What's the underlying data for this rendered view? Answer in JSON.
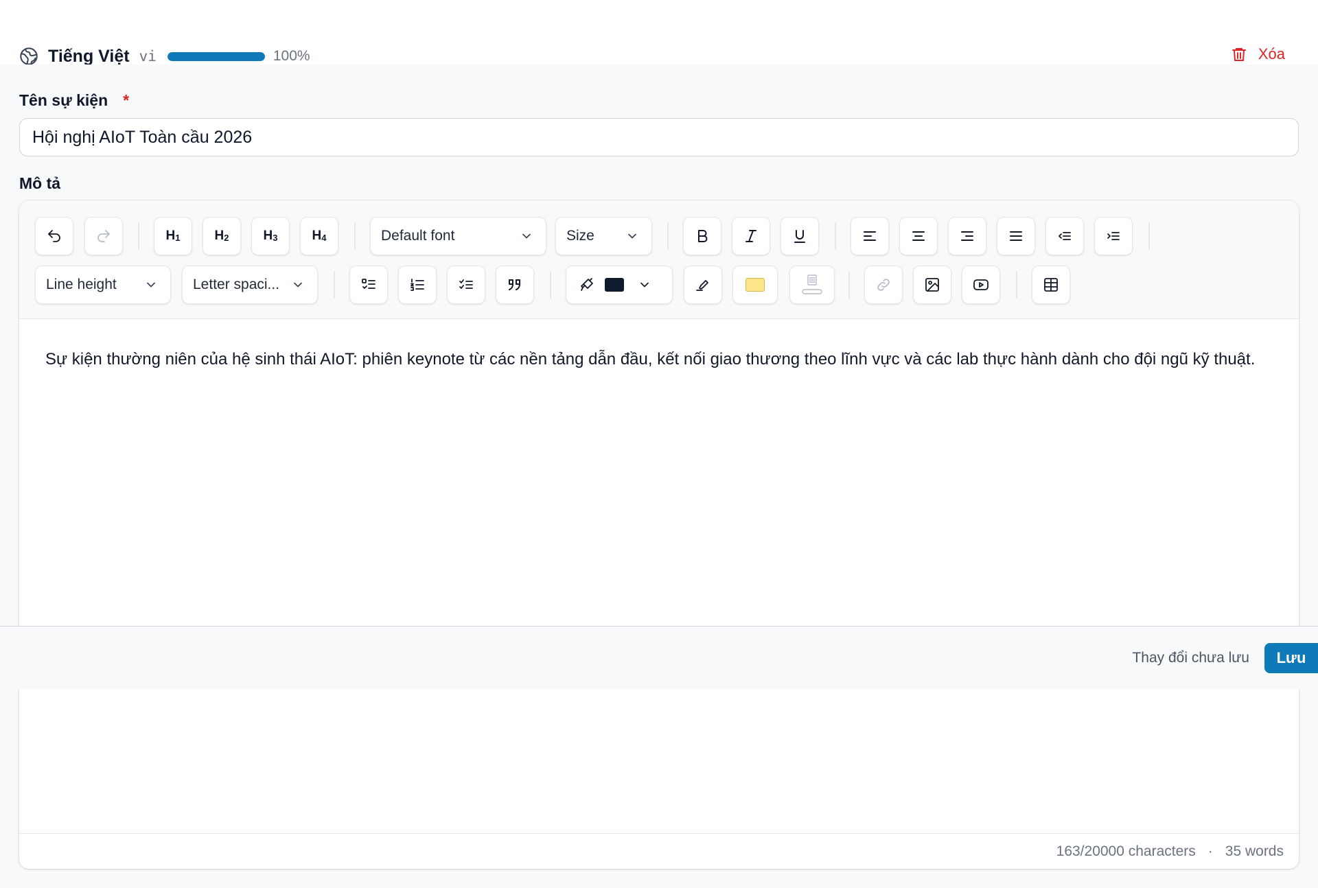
{
  "language": {
    "name": "Tiếng Việt",
    "code": "vi",
    "progress_percent": 100,
    "progress_text": "100%",
    "delete_label": "Xóa"
  },
  "fields": {
    "event_name": {
      "label": "Tên sự kiện",
      "required_mark": "*",
      "value": "Hội nghị AIoT Toàn cầu 2026"
    },
    "description": {
      "label": "Mô tả"
    }
  },
  "toolbar": {
    "heading_1": "H",
    "heading_1_sub": "1",
    "heading_2": "H",
    "heading_2_sub": "2",
    "heading_3": "H",
    "heading_3_sub": "3",
    "heading_4": "H",
    "heading_4_sub": "4",
    "font_select": "Default font",
    "size_select": "Size",
    "line_height_select": "Line height",
    "letter_spacing_select": "Letter spaci...",
    "text_color": "#0f1b2d",
    "highlight_color": "#fde68a",
    "icons": [
      "undo-icon",
      "redo-icon",
      "bold-icon",
      "italic-icon",
      "underline-icon",
      "align-left-icon",
      "align-center-icon",
      "align-right-icon",
      "align-justify-icon",
      "outdent-icon",
      "indent-icon",
      "bullet-list-icon",
      "ordered-list-icon",
      "task-list-icon",
      "blockquote-icon",
      "paint-brush-icon",
      "highlighter-icon",
      "paragraph-background-icon",
      "link-icon",
      "image-icon",
      "video-icon",
      "table-icon"
    ]
  },
  "editor": {
    "content": "Sự kiện thường niên của hệ sinh thái AIoT: phiên keynote từ các nền tảng dẫn đầu, kết nối giao thương theo lĩnh vực và các lab thực hành dành cho đội ngũ kỹ thuật.",
    "char_count": "163/20000 characters",
    "separator": "·",
    "word_count": "35 words"
  },
  "savebar": {
    "status": "Thay đổi chưa lưu",
    "save_label": "Lưu"
  },
  "colors": {
    "accent": "#0e7bb8",
    "danger": "#dc2626"
  }
}
